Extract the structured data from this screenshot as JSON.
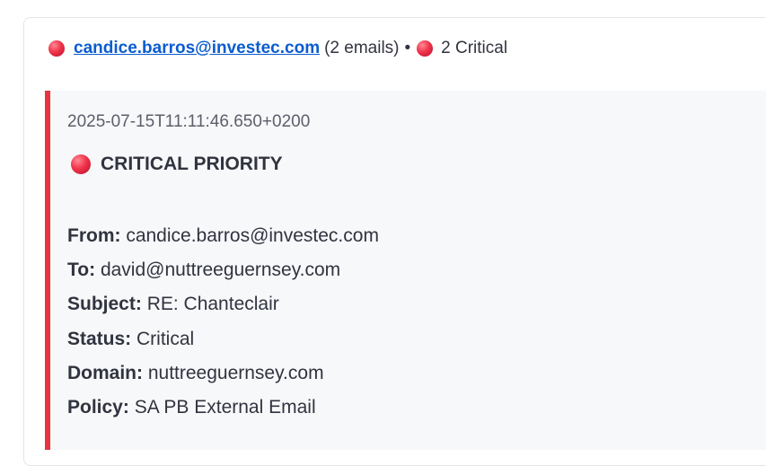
{
  "header": {
    "sender_email": "candice.barros@investec.com",
    "email_count": "(2 emails)",
    "separator": "•",
    "critical_count": "2 Critical"
  },
  "email": {
    "timestamp": "2025-07-15T11:11:46.650+0200",
    "priority_label": "CRITICAL PRIORITY",
    "fields": [
      {
        "key": "From:",
        "value": "candice.barros@investec.com"
      },
      {
        "key": "To:",
        "value": "david@nuttreeguernsey.com"
      },
      {
        "key": "Subject:",
        "value": "RE: Chanteclair"
      },
      {
        "key": "Status:",
        "value": "Critical"
      },
      {
        "key": "Domain:",
        "value": "nuttreeguernsey.com"
      },
      {
        "key": "Policy:",
        "value": "SA PB External Email"
      }
    ]
  },
  "colors": {
    "critical_red": "#e8343f",
    "link_blue": "#0b5ccf",
    "panel_bg": "#f7f8fa"
  },
  "icons": {
    "status_dot": "red-circle-icon"
  }
}
